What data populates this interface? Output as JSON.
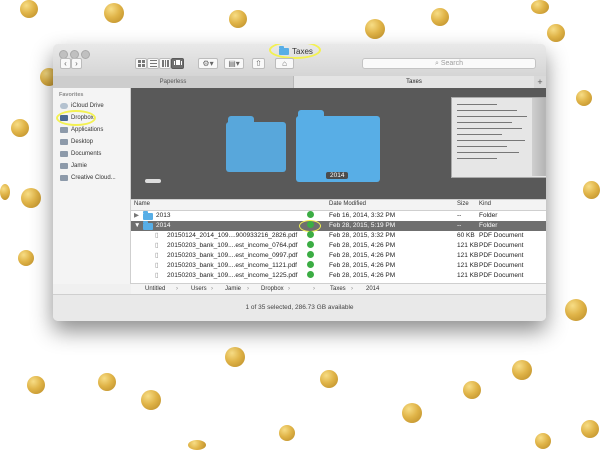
{
  "window": {
    "title": "Taxes"
  },
  "toolbar": {
    "back_label": "‹",
    "forward_label": "›",
    "search_placeholder": "Search"
  },
  "tabs": [
    {
      "label": "Paperless"
    },
    {
      "label": "Taxes"
    }
  ],
  "tab_add": "+",
  "sidebar": {
    "heading": "Favorites",
    "items": [
      {
        "label": "iCloud Drive",
        "icon": "cloud-icon"
      },
      {
        "label": "Dropbox",
        "icon": "dropbox-icon"
      },
      {
        "label": "Applications",
        "icon": "applications-icon"
      },
      {
        "label": "Desktop",
        "icon": "desktop-icon"
      },
      {
        "label": "Documents",
        "icon": "documents-icon"
      },
      {
        "label": "Jamie",
        "icon": "home-icon"
      },
      {
        "label": "Creative Cloud...",
        "icon": "folder-icon"
      }
    ]
  },
  "coverflow": {
    "selected_label": "2014"
  },
  "columns": {
    "name": "Name",
    "date": "Date Modified",
    "size": "Size",
    "kind": "Kind"
  },
  "rows": [
    {
      "name": "2013",
      "date": "Feb 16, 2014, 3:32 PM",
      "size": "--",
      "kind": "Folder"
    },
    {
      "name": "2014",
      "date": "Feb 28, 2015, 5:19 PM",
      "size": "--",
      "kind": "Folder"
    },
    {
      "name": "20150124_2014_109....900933216_2826.pdf",
      "date": "Feb 28, 2015, 3:32 PM",
      "size": "60 KB",
      "kind": "PDF Document"
    },
    {
      "name": "20150203_bank_109....est_income_0764.pdf",
      "date": "Feb 28, 2015, 4:26 PM",
      "size": "121 KB",
      "kind": "PDF Document"
    },
    {
      "name": "20150203_bank_109....est_income_0997.pdf",
      "date": "Feb 28, 2015, 4:26 PM",
      "size": "121 KB",
      "kind": "PDF Document"
    },
    {
      "name": "20150203_bank_109....est_income_1121.pdf",
      "date": "Feb 28, 2015, 4:26 PM",
      "size": "121 KB",
      "kind": "PDF Document"
    },
    {
      "name": "20150203_bank_109....est_income_1225.pdf",
      "date": "Feb 28, 2015, 4:26 PM",
      "size": "121 KB",
      "kind": "PDF Document"
    }
  ],
  "pathbar": [
    "Untitled",
    "Users",
    "Jamie",
    "Dropbox",
    "Taxes",
    "2014"
  ],
  "status": "1 of 35 selected, 286.73 GB available",
  "colors": {
    "folder": "#58aee6",
    "check": "#3cad44",
    "highlight": "#f3f152",
    "gold": "#e0b448"
  }
}
